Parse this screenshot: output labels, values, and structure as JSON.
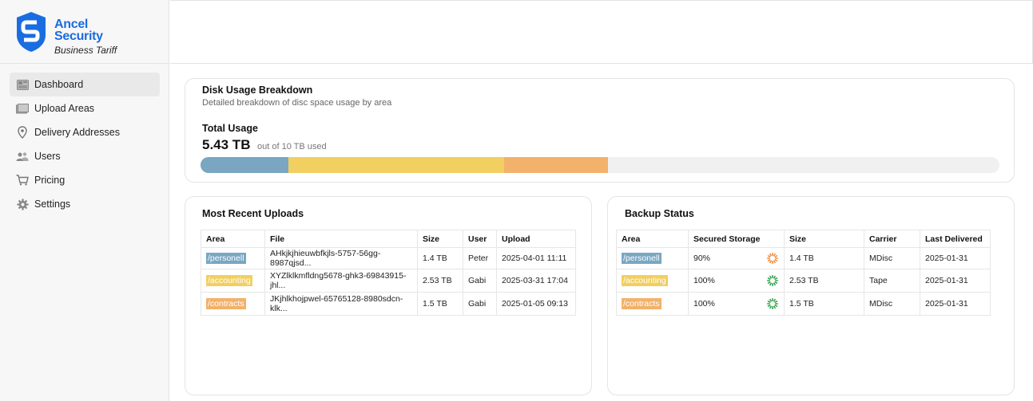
{
  "brand": {
    "line1": "Ancel",
    "line2": "Security",
    "tagline": "Business Tariff",
    "color": "#1a6de0"
  },
  "nav": [
    {
      "label": "Dashboard",
      "icon": "dashboard-icon",
      "active": true
    },
    {
      "label": "Upload Areas",
      "icon": "folders-icon"
    },
    {
      "label": "Delivery Addresses",
      "icon": "map-pin-icon"
    },
    {
      "label": "Users",
      "icon": "users-icon"
    },
    {
      "label": "Pricing",
      "icon": "cart-icon"
    },
    {
      "label": "Settings",
      "icon": "gear-icon"
    }
  ],
  "disk": {
    "title": "Disk Usage Breakdown",
    "subtitle": "Detailed breakdown of disc space usage by area",
    "total_label": "Total Usage",
    "total_value": "5.43 TB",
    "total_of": "out of 10 TB used",
    "capacity_tb": 10,
    "segments": [
      {
        "area": "/personell",
        "tb": 1.1,
        "color": "#7aa6c2"
      },
      {
        "area": "/accounting",
        "tb": 2.7,
        "color": "#f1cf60"
      },
      {
        "area": "/contracts",
        "tb": 1.3,
        "color": "#f2b26b"
      }
    ]
  },
  "uploads": {
    "title": "Most Recent Uploads",
    "columns": [
      "Area",
      "File",
      "Size",
      "User",
      "Upload"
    ],
    "rows": [
      {
        "area": "/personell",
        "area_color": "#7aa6c2",
        "file": "AHkjkjhieuwbfkjls-5757-56gg-8987qjsd...",
        "size": "1.4 TB",
        "user": "Peter",
        "upload": "2025-04-01 11:11"
      },
      {
        "area": "/accounting",
        "area_color": "#f1cf60",
        "file": "XYZlklkmfldng5678-ghk3-69843915-jhl...",
        "size": "2.53 TB",
        "user": "Gabi",
        "upload": "2025-03-31 17:04"
      },
      {
        "area": "/contracts",
        "area_color": "#f2b26b",
        "file": "JKjhlkhojpwel-65765128-8980sdcn-klk...",
        "size": "1.5 TB",
        "user": "Gabi",
        "upload": "2025-01-05 09:13"
      }
    ]
  },
  "backup": {
    "title": "Backup Status",
    "columns": [
      "Area",
      "Secured Storage",
      "Size",
      "Carrier",
      "Last Delivered"
    ],
    "rows": [
      {
        "area": "/personell",
        "area_color": "#7aa6c2",
        "secured": "90%",
        "status_color": "#f08a3c",
        "size": "1.4 TB",
        "carrier": "MDisc",
        "delivered": "2025-01-31"
      },
      {
        "area": "/accounting",
        "area_color": "#f1cf60",
        "secured": "100%",
        "status_color": "#2fa14a",
        "size": "2.53 TB",
        "carrier": "Tape",
        "delivered": "2025-01-31"
      },
      {
        "area": "/contracts",
        "area_color": "#f2b26b",
        "secured": "100%",
        "status_color": "#2fa14a",
        "size": "1.5 TB",
        "carrier": "MDisc",
        "delivered": "2025-01-31"
      }
    ]
  }
}
